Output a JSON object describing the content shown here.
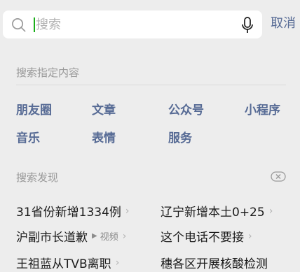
{
  "search": {
    "placeholder": "搜索",
    "value": ""
  },
  "cancel_label": "取消",
  "specify_section": {
    "title": "搜索指定内容",
    "categories": [
      "朋友圈",
      "文章",
      "公众号",
      "小程序",
      "音乐",
      "表情",
      "服务"
    ]
  },
  "discovery": {
    "title": "搜索发现",
    "items": [
      {
        "text": "31省份新增1334例",
        "tag": ""
      },
      {
        "text": "辽宁新增本土0+25",
        "tag": ""
      },
      {
        "text": "沪副市长道歉",
        "tag": "视频"
      },
      {
        "text": "这个电话不要接",
        "tag": ""
      },
      {
        "text": "王祖蓝从TVB离职",
        "tag": ""
      },
      {
        "text": "穗各区开展核酸检测",
        "tag": ""
      }
    ]
  },
  "colors": {
    "accent": "#576b95",
    "caret": "#1aad19",
    "background": "#ededed"
  }
}
